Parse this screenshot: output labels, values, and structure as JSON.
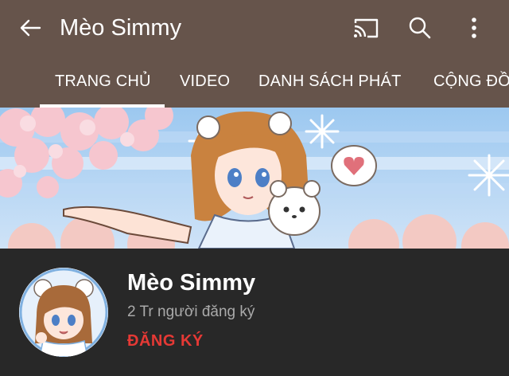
{
  "header": {
    "title": "Mèo Simmy",
    "back_icon": "arrow-left-icon",
    "cast_icon": "cast-icon",
    "search_icon": "search-icon",
    "more_icon": "more-vertical-icon",
    "background_color": "#66544b"
  },
  "tabs": [
    {
      "label": "TRANG CHỦ",
      "selected": true
    },
    {
      "label": "VIDEO",
      "selected": false
    },
    {
      "label": "DANH SÁCH PHÁT",
      "selected": false
    },
    {
      "label": "CỘNG ĐỒ",
      "selected": false
    }
  ],
  "channel": {
    "name": "Mèo Simmy",
    "subscribers": "2 Tr người đăng ký",
    "subscribe_label": "ĐĂNG KÝ",
    "subscribe_color": "#e53935"
  }
}
